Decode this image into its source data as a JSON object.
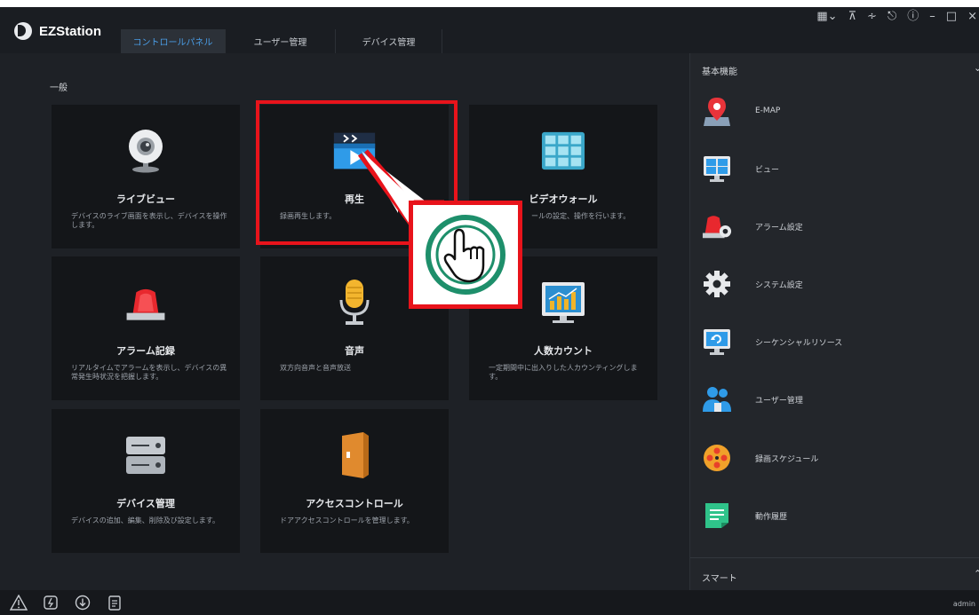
{
  "app": {
    "name": "EZStation"
  },
  "tabs": [
    {
      "label": "コントロールパネル",
      "active": true
    },
    {
      "label": "ユーザー管理",
      "active": false
    },
    {
      "label": "デバイス管理",
      "active": false
    }
  ],
  "window_icons": [
    "layout-icon",
    "skin-icon",
    "link-icon",
    "lock-icon",
    "help-icon",
    "minimize-icon",
    "maximize-icon",
    "close-icon"
  ],
  "section": {
    "title": "一般"
  },
  "cards": [
    {
      "title": "ライブビュー",
      "desc": "デバイスのライブ画面を表示し、デバイスを操作します。",
      "icon": "webcam-icon"
    },
    {
      "title": "再生",
      "desc": "録画再生します。",
      "icon": "playback-clapper-icon"
    },
    {
      "title": "ビデオウォール",
      "desc": "ールの設定、操作を行います。",
      "icon": "video-wall-icon"
    },
    {
      "title": "アラーム記録",
      "desc": "リアルタイムでアラームを表示し、デバイスの異常発生時状況を把握します。",
      "icon": "alarm-light-icon"
    },
    {
      "title": "音声",
      "desc": "双方向音声と音声放送",
      "icon": "microphone-icon"
    },
    {
      "title": "人数カウント",
      "desc": "一定期間中に出入りした人カウンティングします。",
      "icon": "people-count-chart-icon"
    },
    {
      "title": "デバイス管理",
      "desc": "デバイスの追加、編集、削除及び設定します。",
      "icon": "server-icon"
    },
    {
      "title": "アクセスコントロール",
      "desc": "ドアアクセスコントロールを管理します。",
      "icon": "door-icon"
    }
  ],
  "right_panel": {
    "header": "基本機能",
    "items": [
      {
        "label": "E-MAP",
        "icon": "map-pin-icon"
      },
      {
        "label": "ビュー",
        "icon": "monitor-view-icon"
      },
      {
        "label": "アラーム設定",
        "icon": "alarm-settings-icon"
      },
      {
        "label": "システム設定",
        "icon": "gear-icon"
      },
      {
        "label": "シーケンシャルリソース",
        "icon": "sequence-monitor-icon"
      },
      {
        "label": "ユーザー管理",
        "icon": "users-icon"
      },
      {
        "label": "録画スケジュール",
        "icon": "film-reel-icon"
      },
      {
        "label": "動作履歴",
        "icon": "log-document-icon"
      }
    ],
    "footer": "スマート"
  },
  "bottom_bar": {
    "icons": [
      "warning-icon",
      "power-icon",
      "download-icon",
      "clipboard-icon"
    ],
    "user": "admin"
  },
  "colors": {
    "accent_tab": "#4a9de6",
    "highlight_red": "#e8131b",
    "callout_green": "#1e8f6b"
  }
}
